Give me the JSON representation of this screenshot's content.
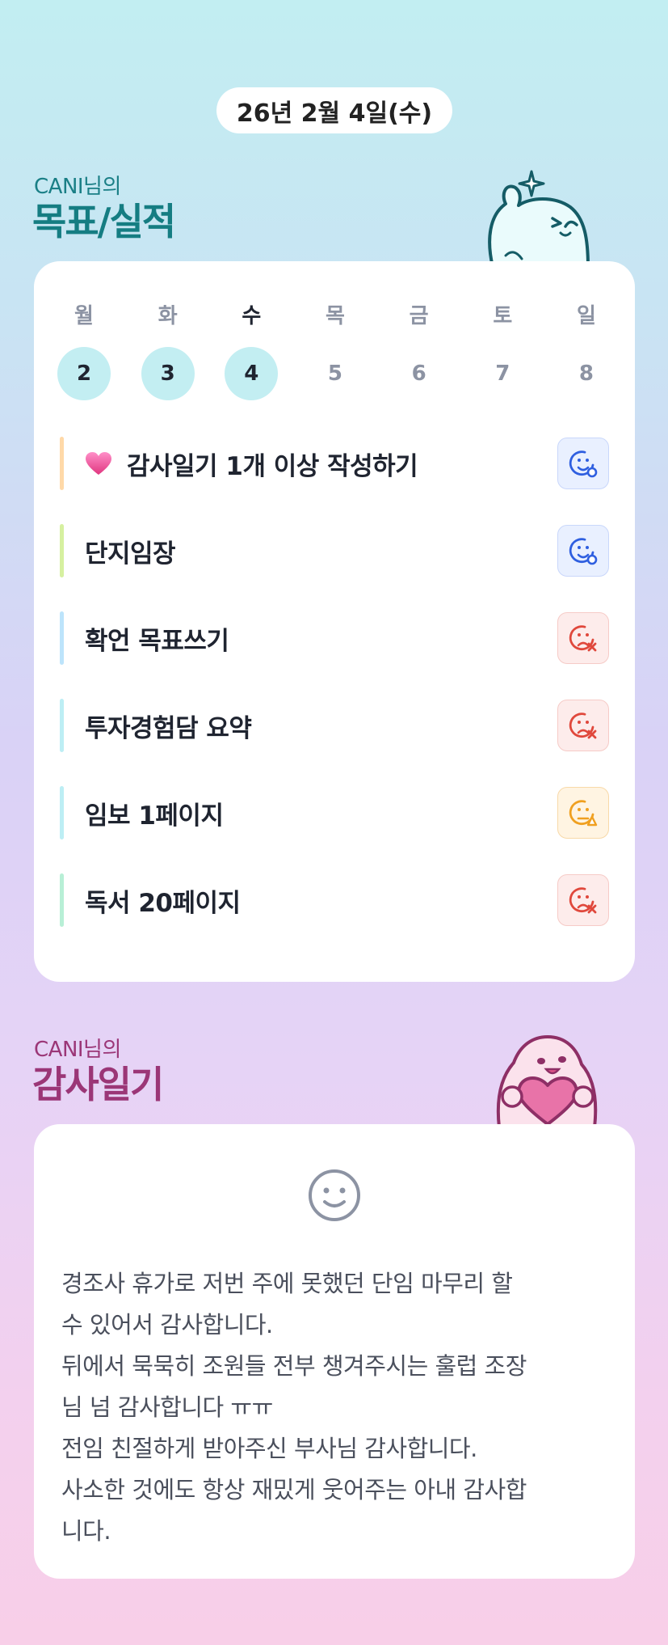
{
  "date": "26년 2월 4일(수)",
  "goals_section": {
    "subtitle": "CANI님의",
    "title": "목표/실적"
  },
  "week": [
    {
      "name": "월",
      "num": "2",
      "done": true,
      "today": false
    },
    {
      "name": "화",
      "num": "3",
      "done": true,
      "today": false
    },
    {
      "name": "수",
      "num": "4",
      "done": true,
      "today": true
    },
    {
      "name": "목",
      "num": "5",
      "done": false,
      "today": false
    },
    {
      "name": "금",
      "num": "6",
      "done": false,
      "today": false
    },
    {
      "name": "토",
      "num": "7",
      "done": false,
      "today": false
    },
    {
      "name": "일",
      "num": "8",
      "done": false,
      "today": false
    }
  ],
  "goals": [
    {
      "label": "감사일기 1개 이상 작성하기",
      "bar_color": "#ffd9a8",
      "status": "good",
      "heart": true
    },
    {
      "label": "단지임장",
      "bar_color": "#d6f0a0",
      "status": "good",
      "heart": false
    },
    {
      "label": "확언 목표쓰기",
      "bar_color": "#bde4fb",
      "status": "bad",
      "heart": false
    },
    {
      "label": "투자경험담 요약",
      "bar_color": "#bdeef4",
      "status": "bad",
      "heart": false
    },
    {
      "label": "임보 1페이지",
      "bar_color": "#bdeef4",
      "status": "warn",
      "heart": false
    },
    {
      "label": "독서 20페이지",
      "bar_color": "#b8efd6",
      "status": "bad",
      "heart": false
    }
  ],
  "status_colors": {
    "good": "#2f5fe0",
    "bad": "#e0483c",
    "warn": "#f0a020"
  },
  "gratitude_section": {
    "subtitle": "CANI님의",
    "title": "감사일기"
  },
  "gratitude": {
    "icon": "smile-face-icon",
    "lines": [
      "경조사 휴가로 저번 주에 못했던 단임 마무리 할",
      "수 있어서 감사합니다.",
      "뒤에서 묵묵히 조원들 전부 챙겨주시는 훌럽 조장",
      "님 넘 감사합니다 ㅠㅠ",
      "전임 친절하게 받아주신 부사님 감사합니다.",
      "사소한 것에도 항상 재밌게 웃어주는 아내 감사합",
      "니다."
    ]
  }
}
